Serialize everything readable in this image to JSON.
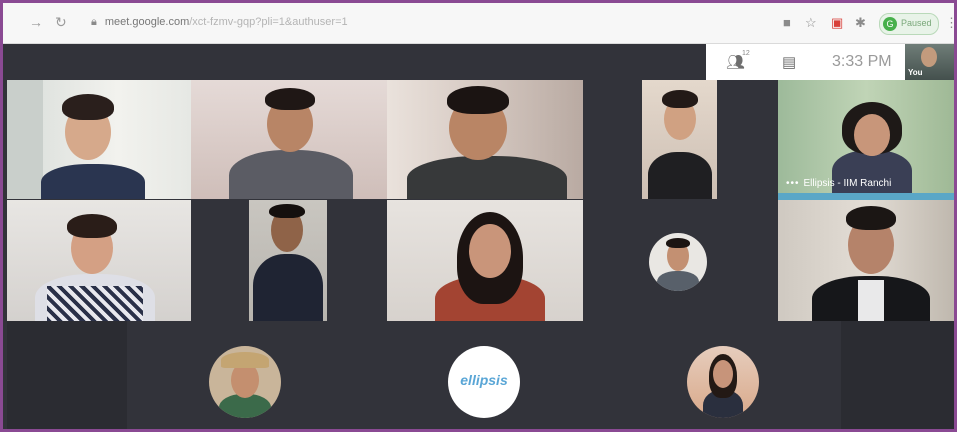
{
  "browser": {
    "url_host": "meet.google.com",
    "url_path": "/xct-fzmv-gqp?pli=1&authuser=1",
    "profile_label": "Paused",
    "profile_initial": "G"
  },
  "meet": {
    "time": "3:33 PM",
    "people_count": "12",
    "self_label": "You"
  },
  "participants": [
    {
      "id": "p1",
      "label": ""
    },
    {
      "id": "p2",
      "label": ""
    },
    {
      "id": "p3",
      "label": ""
    },
    {
      "id": "p4",
      "label": ""
    },
    {
      "id": "p5",
      "label": "Ellipsis - IIM Ranchi"
    },
    {
      "id": "p6",
      "label": ""
    },
    {
      "id": "p7",
      "label": ""
    },
    {
      "id": "p8",
      "label": ""
    },
    {
      "id": "p9",
      "label": ""
    },
    {
      "id": "p10",
      "label": ""
    },
    {
      "id": "p11",
      "label": ""
    },
    {
      "id": "p12",
      "label": ""
    },
    {
      "id": "p13",
      "label": ""
    }
  ],
  "logo": {
    "text": "ellipsis"
  },
  "colors": {
    "frame_border": "#8a4a93",
    "meet_bg": "#32333a",
    "profile_green": "#47b04b"
  },
  "icons": [
    "back-arrow-icon",
    "reload-icon",
    "lock-icon",
    "camera-icon",
    "star-icon",
    "extension-icon",
    "puzzle-icon",
    "menu-dots-icon",
    "people-icon",
    "chat-icon"
  ]
}
